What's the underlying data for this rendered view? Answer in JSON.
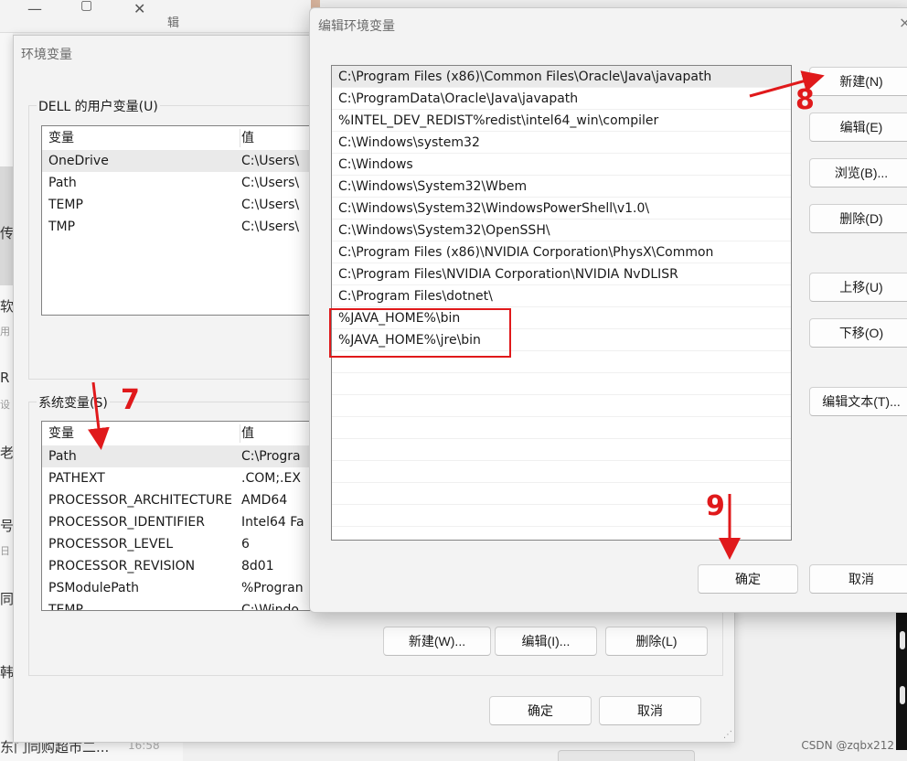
{
  "background": {
    "tab_text": "辑",
    "left_chips": [
      "传",
      "软",
      "用",
      "R",
      "设",
      "老",
      "号",
      "日",
      "同",
      "韩"
    ],
    "bottom_text": "东门同购超市二...",
    "bottom_time": "16:58",
    "watermark": "CSDN @zqbx212"
  },
  "env_dialog": {
    "title": "环境变量",
    "user_vars": {
      "label": "DELL 的用户变量(U)",
      "header": {
        "name": "变量",
        "value": "值"
      },
      "rows": [
        {
          "name": "OneDrive",
          "value": "C:\\Users\\"
        },
        {
          "name": "Path",
          "value": "C:\\Users\\"
        },
        {
          "name": "TEMP",
          "value": "C:\\Users\\"
        },
        {
          "name": "TMP",
          "value": "C:\\Users\\"
        }
      ]
    },
    "system_vars": {
      "label": "系统变量(S)",
      "header": {
        "name": "变量",
        "value": "值"
      },
      "rows": [
        {
          "name": "Path",
          "value": "C:\\Progra"
        },
        {
          "name": "PATHEXT",
          "value": ".COM;.EX"
        },
        {
          "name": "PROCESSOR_ARCHITECTURE",
          "value": "AMD64"
        },
        {
          "name": "PROCESSOR_IDENTIFIER",
          "value": "Intel64 Fa"
        },
        {
          "name": "PROCESSOR_LEVEL",
          "value": "6"
        },
        {
          "name": "PROCESSOR_REVISION",
          "value": "8d01"
        },
        {
          "name": "PSModulePath",
          "value": "%Progran"
        },
        {
          "name": "TEMP",
          "value": "C:\\Windo"
        }
      ],
      "buttons": {
        "new": "新建(W)...",
        "edit": "编辑(I)...",
        "delete": "删除(L)"
      }
    },
    "footer": {
      "ok": "确定",
      "cancel": "取消"
    }
  },
  "edit_dialog": {
    "title": "编辑环境变量",
    "close_glyph": "×",
    "paths": [
      "C:\\Program Files (x86)\\Common Files\\Oracle\\Java\\javapath",
      "C:\\ProgramData\\Oracle\\Java\\javapath",
      "%INTEL_DEV_REDIST%redist\\intel64_win\\compiler",
      "C:\\Windows\\system32",
      "C:\\Windows",
      "C:\\Windows\\System32\\Wbem",
      "C:\\Windows\\System32\\WindowsPowerShell\\v1.0\\",
      "C:\\Windows\\System32\\OpenSSH\\",
      "C:\\Program Files (x86)\\NVIDIA Corporation\\PhysX\\Common",
      "C:\\Program Files\\NVIDIA Corporation\\NVIDIA NvDLISR",
      "C:\\Program Files\\dotnet\\",
      "%JAVA_HOME%\\bin",
      "%JAVA_HOME%\\jre\\bin"
    ],
    "buttons": {
      "new": "新建(N)",
      "edit": "编辑(E)",
      "browse": "浏览(B)...",
      "delete": "删除(D)",
      "move_up": "上移(U)",
      "move_down": "下移(O)",
      "edit_text": "编辑文本(T)...",
      "ok": "确定",
      "cancel": "取消"
    }
  },
  "annotations": {
    "step7": "7",
    "step8": "8",
    "step9": "9",
    "color": "#e0191b"
  }
}
